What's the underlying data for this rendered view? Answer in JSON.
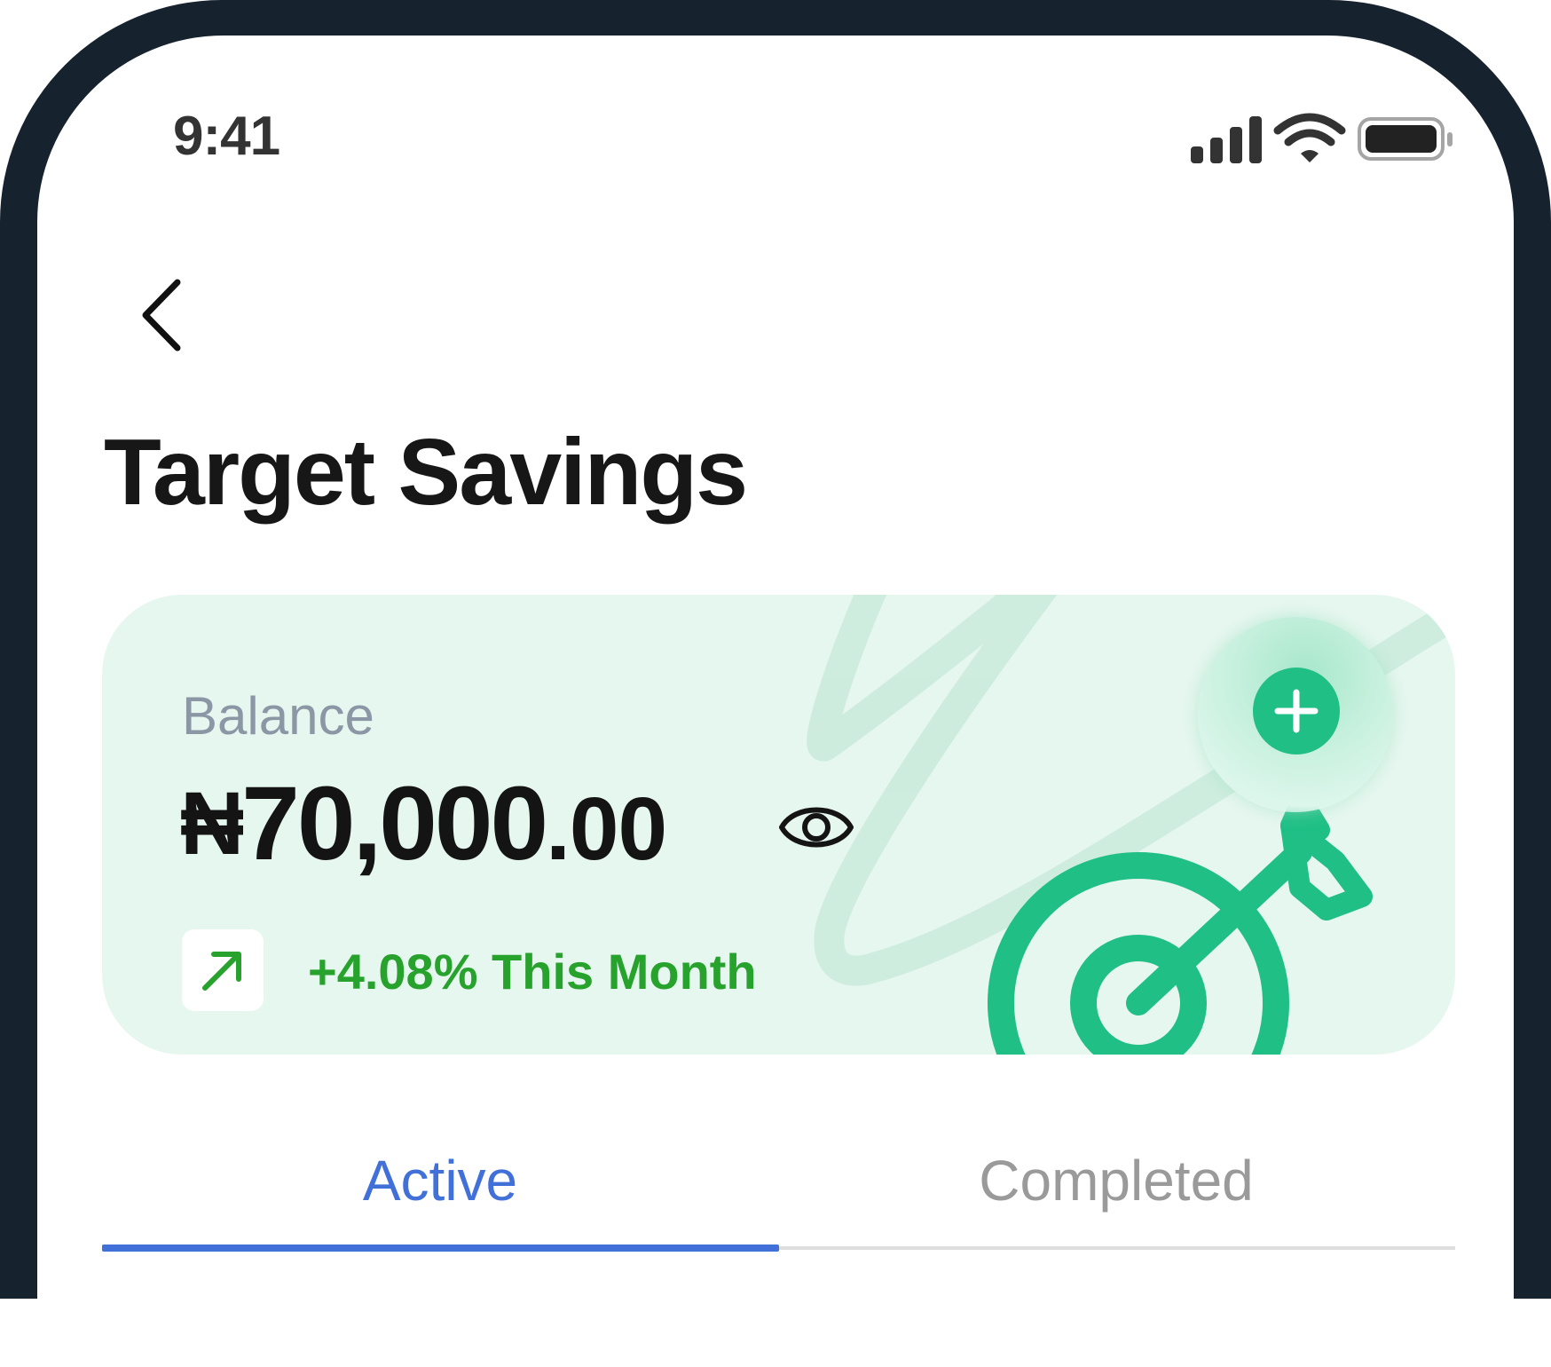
{
  "status_bar": {
    "time": "9:41",
    "icons": [
      "signal-icon",
      "wifi-icon",
      "battery-icon"
    ]
  },
  "header": {
    "back_icon": "chevron-left-icon",
    "title": "Target Savings"
  },
  "balance_card": {
    "label": "Balance",
    "currency": "₦",
    "amount_whole": "70,000",
    "amount_fraction": ".00",
    "visibility_icon": "eye-icon",
    "trend_icon": "arrow-up-right-icon",
    "trend_text": "+4.08% This Month",
    "add_icon": "plus-icon",
    "illustration_icon": "target-arrow-icon"
  },
  "tabs": {
    "items": [
      {
        "label": "Active",
        "selected": true
      },
      {
        "label": "Completed",
        "selected": false
      }
    ]
  },
  "colors": {
    "bezel": "#16222e",
    "card_background": "#e6f7ef",
    "brand_green": "#1fbf86",
    "trend_green": "#27a22c",
    "tab_active": "#4070d8",
    "tab_inactive": "#9a9a9a",
    "label_gray": "#8c97a6"
  }
}
